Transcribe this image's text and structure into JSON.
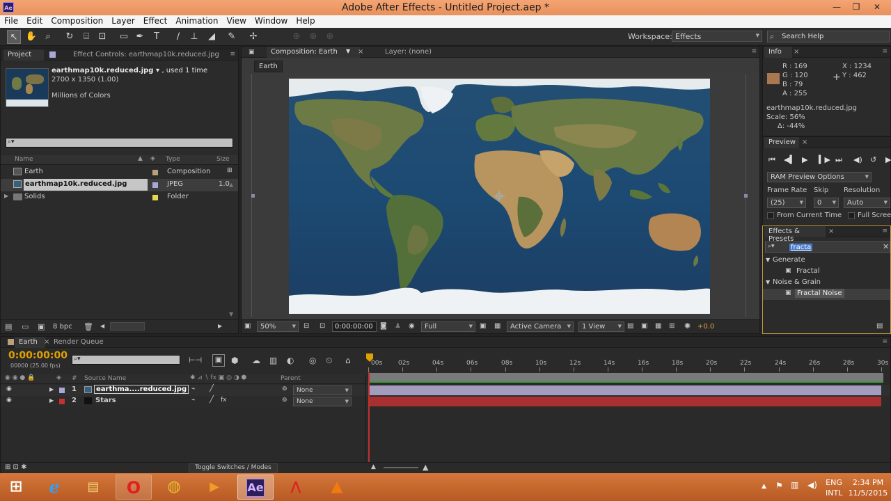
{
  "window": {
    "title": "Adobe After Effects - Untitled Project.aep *",
    "app_icon": "Ae",
    "min": "—",
    "max": "❐",
    "close": "✕"
  },
  "menu": [
    "File",
    "Edit",
    "Composition",
    "Layer",
    "Effect",
    "Animation",
    "View",
    "Window",
    "Help"
  ],
  "toolbar": {
    "workspace_label": "Workspace:",
    "workspace_value": "Effects",
    "search_help": "Search Help"
  },
  "project": {
    "tab_project": "Project",
    "tab_effect_controls": "Effect Controls: earthmap10k.reduced.jpg",
    "file_name": "earthmap10k.reduced.jpg",
    "file_used": ", used 1 time",
    "file_dims": "2700 x 1350 (1.00)",
    "file_colors": "Millions of Colors",
    "columns": {
      "name": "Name",
      "type": "Type",
      "size": "Size"
    },
    "items": [
      {
        "name": "Earth",
        "type": "Composition",
        "size": "",
        "color": "#b8a07a",
        "icon": "composition-icon"
      },
      {
        "name": "earthmap10k.reduced.jpg",
        "type": "JPEG",
        "size": "1.0",
        "color": "#a8a8d8",
        "icon": "image-icon"
      },
      {
        "name": "Solids",
        "type": "Folder",
        "size": "",
        "color": "#e6d84a",
        "icon": "folder-icon"
      }
    ],
    "bpc": "8 bpc"
  },
  "composition": {
    "tab": "Composition: Earth",
    "layer_tab": "Layer: (none)",
    "breadcrumb": "Earth",
    "zoom": "50%",
    "timecode": "0:00:00:00",
    "resolution": "Full",
    "camera": "Active Camera",
    "views": "1 View",
    "exposure": "+0.0"
  },
  "info": {
    "tab": "Info",
    "r": "R : 169",
    "g": "G : 120",
    "b": "B : 79",
    "a": "A : 255",
    "x": "X : 1234",
    "y": "Y : 462",
    "swatch": "#a97850",
    "file": "earthmap10k.reduced.jpg",
    "scale": "Scale: 56%",
    "delta": "Δ: -44%"
  },
  "preview": {
    "tab": "Preview",
    "ram_options": "RAM Preview Options",
    "frame_rate_label": "Frame Rate",
    "skip_label": "Skip",
    "resolution_label": "Resolution",
    "frame_rate": "(25)",
    "skip": "0",
    "resolution": "Auto",
    "from_current": "From Current Time",
    "full_screen": "Full Screen"
  },
  "effects_presets": {
    "tab": "Effects & Presets",
    "search": "fracta",
    "groups": [
      {
        "name": "Generate",
        "items": [
          "Fractal"
        ]
      },
      {
        "name": "Noise & Grain",
        "items": [
          "Fractal Noise"
        ]
      }
    ]
  },
  "timeline": {
    "tab_comp": "Earth",
    "tab_render": "Render Queue",
    "timecode": "0:00:00:00",
    "fps": "00000 (25.00 fps)",
    "col_source": "Source Name",
    "col_parent": "Parent",
    "col_num": "#",
    "layers": [
      {
        "num": "1",
        "name": "earthma....reduced.jpg",
        "parent": "None",
        "color": "#a8a8d8",
        "bar": "#a39cbf"
      },
      {
        "num": "2",
        "name": "Stars",
        "parent": "None",
        "color": "#c73030",
        "bar": "#a83030"
      }
    ],
    "ruler": [
      "00s",
      "02s",
      "04s",
      "06s",
      "08s",
      "10s",
      "12s",
      "14s",
      "16s",
      "18s",
      "20s",
      "22s",
      "24s",
      "26s",
      "28s",
      "30s"
    ],
    "toggle": "Toggle Switches / Modes"
  },
  "taskbar": {
    "lang": "ENG",
    "lang2": "INTL",
    "time": "2:34 PM",
    "date": "11/5/2015",
    "apps": [
      "windows-start",
      "internet-explorer",
      "file-explorer",
      "opera",
      "chrome",
      "media-player",
      "after-effects",
      "acrobat",
      "vlc"
    ]
  }
}
